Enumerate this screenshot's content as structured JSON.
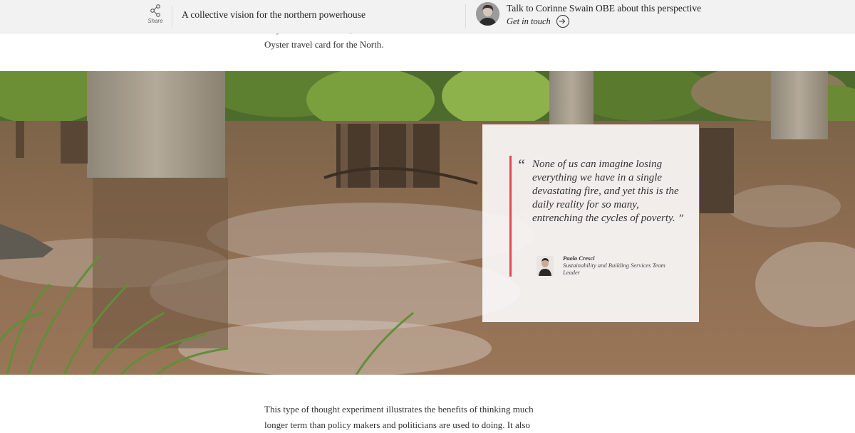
{
  "header": {
    "share_label": "Share",
    "article_title": "A collective vision for the northern powerhouse",
    "contact_text": "Talk to Corinne Swain OBE about this perspective",
    "contact_link": "Get in touch"
  },
  "article": {
    "paragraph_top_partial": "…ly … … … … … …,",
    "paragraph_top_end": "Oyster travel card for the North.",
    "paragraph_bottom_line1": "This type of thought experiment illustrates the benefits of thinking much",
    "paragraph_bottom_line2": "longer term than policy makers and politicians are used to doing. It also"
  },
  "quote": {
    "open_mark": "“",
    "text": "None of us can imagine losing everything we have in a single devastating fire, and yet this is the daily reality for so many, entrenching the cycles of poverty. ”",
    "author_name": "Paolo Cresci",
    "author_role": "Sustainability and Building Services Team Leader"
  },
  "colors": {
    "accent_rule": "#e04a4f",
    "header_bg": "#f2f2f2",
    "river": "#8a6a4e"
  },
  "icons": {
    "share": "share-icon",
    "arrow": "arrow-right-circle-icon"
  }
}
